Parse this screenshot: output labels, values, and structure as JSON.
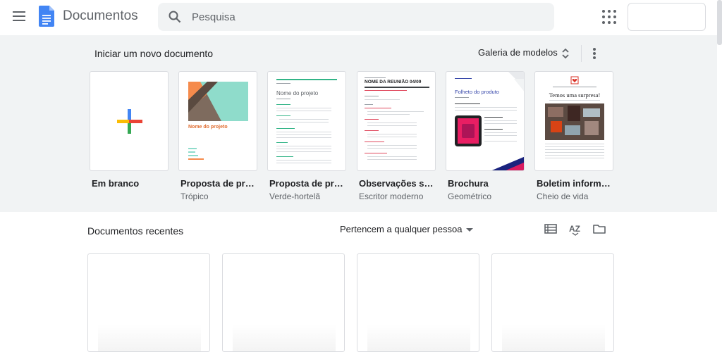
{
  "header": {
    "app_title": "Documentos",
    "search_placeholder": "Pesquisa"
  },
  "gallery": {
    "title": "Iniciar um novo documento",
    "gallery_link": "Galeria de modelos",
    "templates": [
      {
        "name": "Em branco",
        "subtitle": "",
        "thumb_title": ""
      },
      {
        "name": "Proposta de proj...",
        "subtitle": "Trópico",
        "thumb_title": "Nome do projeto"
      },
      {
        "name": "Proposta de proj...",
        "subtitle": "Verde-hortelã",
        "thumb_title": "Nome do projeto"
      },
      {
        "name": "Observações sob...",
        "subtitle": "Escritor moderno",
        "thumb_title": "NOME DA REUNIÃO 04/09"
      },
      {
        "name": "Brochura",
        "subtitle": "Geométrico",
        "thumb_title": "Folheto do produto"
      },
      {
        "name": "Boletim informati...",
        "subtitle": "Cheio de vida",
        "thumb_title": "Temos uma surpresa!"
      }
    ]
  },
  "recent": {
    "title": "Documentos recentes",
    "owner_filter": "Pertencem a qualquer pessoa"
  },
  "colors": {
    "accent_blue": "#4285f4",
    "accent_red": "#ea4335",
    "accent_yellow": "#fbbc04",
    "accent_green": "#34a853",
    "gallery_bg": "#f1f3f4"
  }
}
